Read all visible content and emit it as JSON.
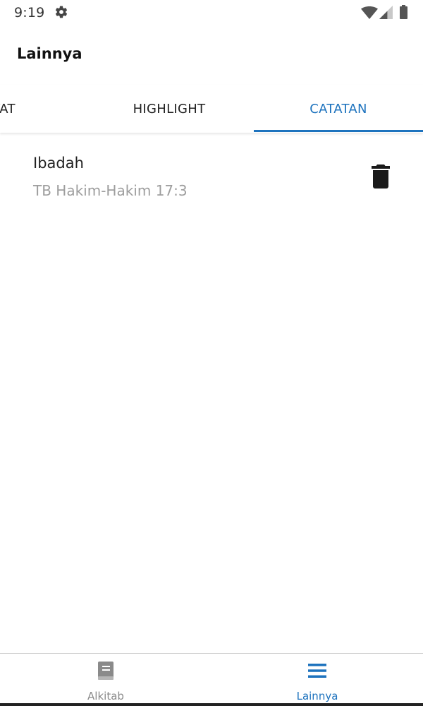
{
  "status_bar": {
    "time": "9:19",
    "settings_icon": "gear-icon",
    "wifi_icon": "wifi-icon",
    "signal_icon": "cell-signal-icon",
    "battery_icon": "battery-icon"
  },
  "app_bar": {
    "title": "Lainnya"
  },
  "tabs": [
    {
      "label": "AYAT",
      "selected": false
    },
    {
      "label": "HIGHLIGHT",
      "selected": false
    },
    {
      "label": "CATATAN",
      "selected": true
    }
  ],
  "notes": [
    {
      "title": "Ibadah",
      "reference": "TB Hakim-Hakim 17:3",
      "action_icon": "trash-icon"
    }
  ],
  "bottom_nav": {
    "items": [
      {
        "label": "Alkitab",
        "icon": "book-icon",
        "selected": false
      },
      {
        "label": "Lainnya",
        "icon": "menu-icon",
        "selected": true
      }
    ]
  },
  "colors": {
    "accent": "#1e73be",
    "text_primary": "#222222",
    "text_secondary": "#9e9e9e",
    "nav_inactive": "#8a8a8a"
  }
}
